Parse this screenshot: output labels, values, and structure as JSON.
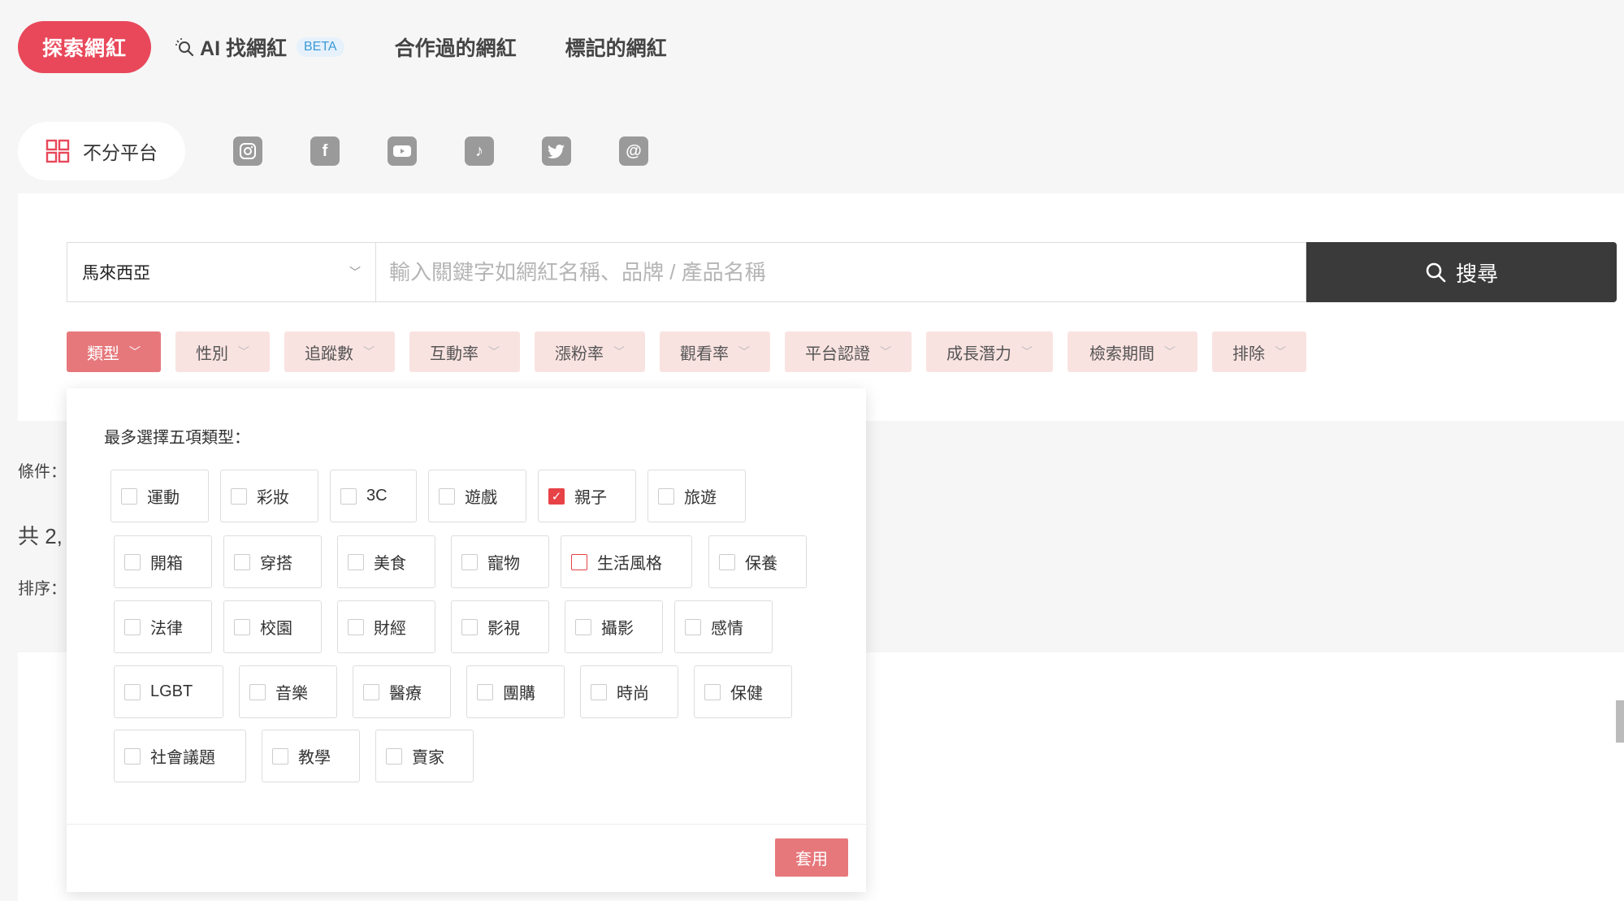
{
  "nav": {
    "explore": "探索網紅",
    "ai_find": "AI 找網紅",
    "beta": "BETA",
    "collaborated": "合作過的網紅",
    "tagged": "標記的網紅"
  },
  "platforms": {
    "all_label": "不分平台",
    "icons": [
      "instagram-icon",
      "facebook-icon",
      "youtube-icon",
      "tiktok-icon",
      "twitter-icon",
      "threads-icon"
    ]
  },
  "search": {
    "region": "馬來西亞",
    "placeholder": "輸入關鍵字如網紅名稱、品牌 / 產品名稱",
    "button": "搜尋"
  },
  "filters": [
    "類型",
    "性別",
    "追蹤數",
    "互動率",
    "漲粉率",
    "觀看率",
    "平台認證",
    "成長潛力",
    "檢索期間",
    "排除"
  ],
  "side": {
    "conditions": "條件：",
    "total": "共 2,",
    "sort": "排序："
  },
  "dropdown": {
    "title": "最多選擇五項類型：",
    "rows": [
      [
        {
          "label": "運動",
          "checked": false
        },
        {
          "label": "彩妝",
          "checked": false
        },
        {
          "label": "3C",
          "checked": false
        },
        {
          "label": "遊戲",
          "checked": false
        },
        {
          "label": "親子",
          "checked": true
        },
        {
          "label": "旅遊",
          "checked": false
        }
      ],
      [
        {
          "label": "開箱",
          "checked": false
        },
        {
          "label": "穿搭",
          "checked": false
        },
        {
          "label": "美食",
          "checked": false
        },
        {
          "label": "寵物",
          "checked": false
        },
        {
          "label": "生活風格",
          "checked": false
        },
        {
          "label": "保養",
          "checked": false
        }
      ],
      [
        {
          "label": "法律",
          "checked": false
        },
        {
          "label": "校園",
          "checked": false
        },
        {
          "label": "財經",
          "checked": false
        },
        {
          "label": "影視",
          "checked": false
        },
        {
          "label": "攝影",
          "checked": false
        },
        {
          "label": "感情",
          "checked": false
        }
      ],
      [
        {
          "label": "LGBT",
          "checked": false
        },
        {
          "label": "音樂",
          "checked": false
        },
        {
          "label": "醫療",
          "checked": false
        },
        {
          "label": "團購",
          "checked": false
        },
        {
          "label": "時尚",
          "checked": false
        },
        {
          "label": "保健",
          "checked": false
        }
      ],
      [
        {
          "label": "社會議題",
          "checked": false
        },
        {
          "label": "教學",
          "checked": false
        },
        {
          "label": "賣家",
          "checked": false
        }
      ]
    ],
    "apply": "套用"
  },
  "colors": {
    "accent": "#e8485a",
    "chip_bg": "#f9e3e1",
    "chip_active": "#e6787c",
    "search_btn": "#3a3a3a",
    "check": "#e74246"
  }
}
